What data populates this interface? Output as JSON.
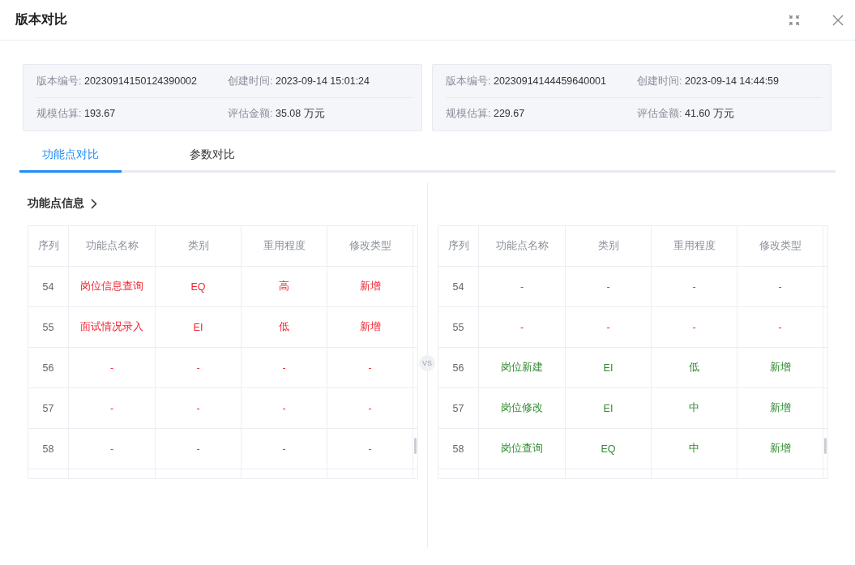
{
  "dialog": {
    "title": "版本对比"
  },
  "versions": [
    {
      "fields": [
        {
          "label": "版本编号:",
          "value": "20230914150124390002"
        },
        {
          "label": "创建时间:",
          "value": "2023-09-14 15:01:24"
        },
        {
          "label": "规模估算:",
          "value": "193.67"
        },
        {
          "label": "评估金额:",
          "value": "35.08 万元"
        }
      ]
    },
    {
      "fields": [
        {
          "label": "版本编号:",
          "value": "20230914144459640001"
        },
        {
          "label": "创建时间:",
          "value": "2023-09-14 14:44:59"
        },
        {
          "label": "规模估算:",
          "value": "229.67"
        },
        {
          "label": "评估金额:",
          "value": "41.60 万元"
        }
      ]
    }
  ],
  "tabs": [
    {
      "label": "功能点对比",
      "selected": true
    },
    {
      "label": "参数对比",
      "selected": false
    }
  ],
  "section": {
    "title": "功能点信息"
  },
  "vs_label": "VS",
  "tables": [
    {
      "columns": [
        "序列",
        "功能点名称",
        "类别",
        "重用程度",
        "修改类型"
      ],
      "rows": [
        {
          "kind": "removed",
          "cells": [
            "54",
            "岗位信息查询",
            "EQ",
            "高",
            "新增"
          ]
        },
        {
          "kind": "removed",
          "cells": [
            "55",
            "面试情况录入",
            "EI",
            "低",
            "新增"
          ]
        },
        {
          "kind": "missing",
          "cells": [
            "56",
            "-",
            "-",
            "-",
            "-"
          ]
        },
        {
          "kind": "missing",
          "cells": [
            "57",
            "-",
            "-",
            "-",
            "-"
          ]
        },
        {
          "kind": "missing",
          "cells": [
            "58",
            "-",
            "-",
            "-",
            "-"
          ]
        }
      ]
    },
    {
      "columns": [
        "序列",
        "功能点名称",
        "类别",
        "重用程度",
        "修改类型"
      ],
      "rows": [
        {
          "kind": "missing",
          "cells": [
            "54",
            "-",
            "-",
            "-",
            "-"
          ]
        },
        {
          "kind": "missing",
          "cells": [
            "55",
            "-",
            "-",
            "-",
            "-"
          ]
        },
        {
          "kind": "added",
          "cells": [
            "56",
            "岗位新建",
            "EI",
            "低",
            "新增"
          ]
        },
        {
          "kind": "added",
          "cells": [
            "57",
            "岗位修改",
            "EI",
            "中",
            "新增"
          ]
        },
        {
          "kind": "added",
          "cells": [
            "58",
            "岗位查询",
            "EQ",
            "中",
            "新增"
          ]
        }
      ]
    }
  ]
}
